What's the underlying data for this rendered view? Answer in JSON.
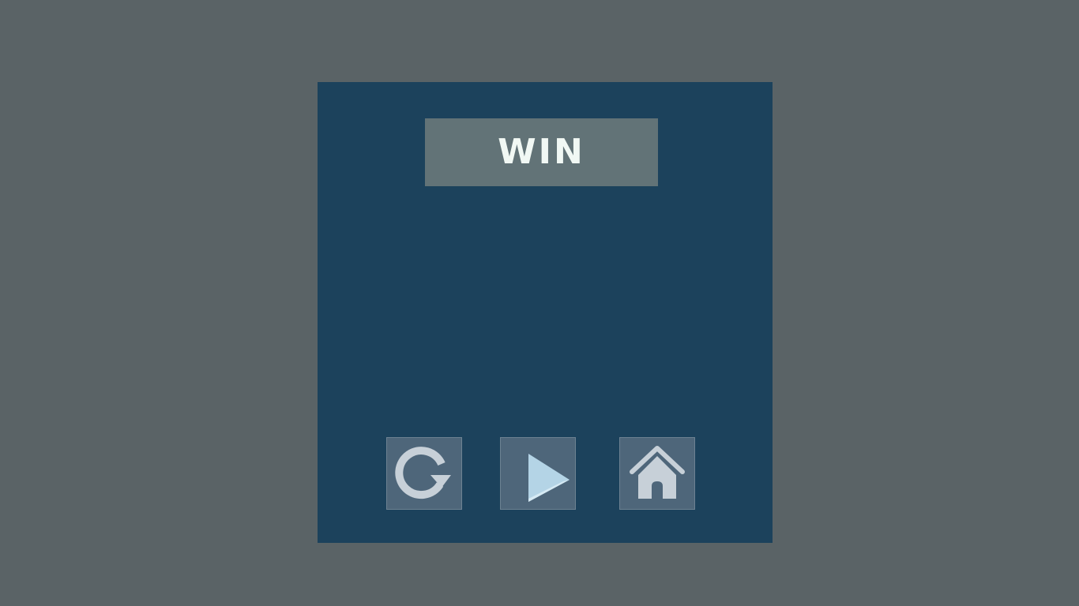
{
  "result": {
    "title": "WIN"
  },
  "buttons": [
    {
      "name": "restart",
      "icon": "restart-icon"
    },
    {
      "name": "next-level",
      "icon": "play-icon"
    },
    {
      "name": "home",
      "icon": "home-icon"
    }
  ],
  "colors": {
    "background": "#5a6366",
    "panel": "#1c425c",
    "title_box": "#627377",
    "title_text": "#f1f8f4",
    "button": "#4e667a",
    "icon": "#c7d0d8",
    "play_icon": "#b4d4e6"
  }
}
